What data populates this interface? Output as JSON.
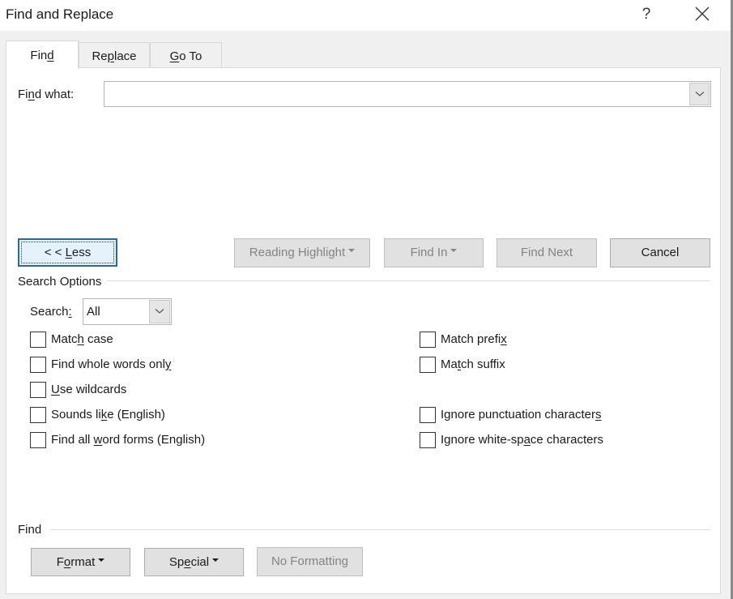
{
  "window": {
    "title": "Find and Replace",
    "help_label": "?",
    "close_icon": "close-icon"
  },
  "tabs": [
    {
      "label_pre": "Fin",
      "label_u": "d",
      "label_post": "",
      "active": true
    },
    {
      "label_pre": "Re",
      "label_u": "p",
      "label_post": "lace",
      "active": false
    },
    {
      "label_pre": "",
      "label_u": "G",
      "label_post": "o To",
      "active": false
    }
  ],
  "find": {
    "label_pre": "Fi",
    "label_u": "n",
    "label_post": "d what:",
    "value": "",
    "placeholder": ""
  },
  "buttons": {
    "less": {
      "label_pre": "< < ",
      "label_u": "L",
      "label_post": "ess",
      "enabled": true,
      "focused": true
    },
    "reading_highlight": {
      "label": "Reading Highlight",
      "enabled": false,
      "dropdown": true
    },
    "find_in": {
      "label": "Find In",
      "enabled": false,
      "dropdown": true
    },
    "find_next": {
      "label": "Find Next",
      "enabled": false
    },
    "cancel": {
      "label": "Cancel",
      "enabled": true
    }
  },
  "search_options": {
    "group_label": "Search Options",
    "search_label_pre": "Search",
    "search_label_u": ":",
    "search_value": "All",
    "left_options": [
      {
        "pre": "Matc",
        "u": "h",
        "post": " case",
        "checked": false
      },
      {
        "pre": "Find whole words onl",
        "u": "y",
        "post": "",
        "checked": false
      },
      {
        "pre": "",
        "u": "U",
        "post": "se wildcards",
        "checked": false
      },
      {
        "pre": "Sounds li",
        "u": "k",
        "post": "e (English)",
        "checked": false
      },
      {
        "pre": "Find all ",
        "u": "w",
        "post": "ord forms (English)",
        "checked": false
      }
    ],
    "right_options": [
      {
        "pre": "Match prefi",
        "u": "x",
        "post": "",
        "checked": false
      },
      {
        "pre": "Ma",
        "u": "t",
        "post": "ch suffix",
        "checked": false
      },
      {
        "pre": "Ignore punctuation character",
        "u": "s",
        "post": "",
        "checked": false
      },
      {
        "pre": "Ignore white-sp",
        "u": "a",
        "post": "ce characters",
        "checked": false
      }
    ]
  },
  "find_group": {
    "label": "Find",
    "format": {
      "pre": "F",
      "u": "o",
      "post": "rmat",
      "enabled": true,
      "dropdown": true
    },
    "special": {
      "pre": "Sp",
      "u": "e",
      "post": "cial",
      "enabled": true,
      "dropdown": true
    },
    "no_formatting": {
      "label": "No Formatting",
      "enabled": false
    }
  },
  "colors": {
    "focus_border": "#2a6a9a",
    "disabled_text": "#838383",
    "button_bg": "#e1e1e1"
  }
}
